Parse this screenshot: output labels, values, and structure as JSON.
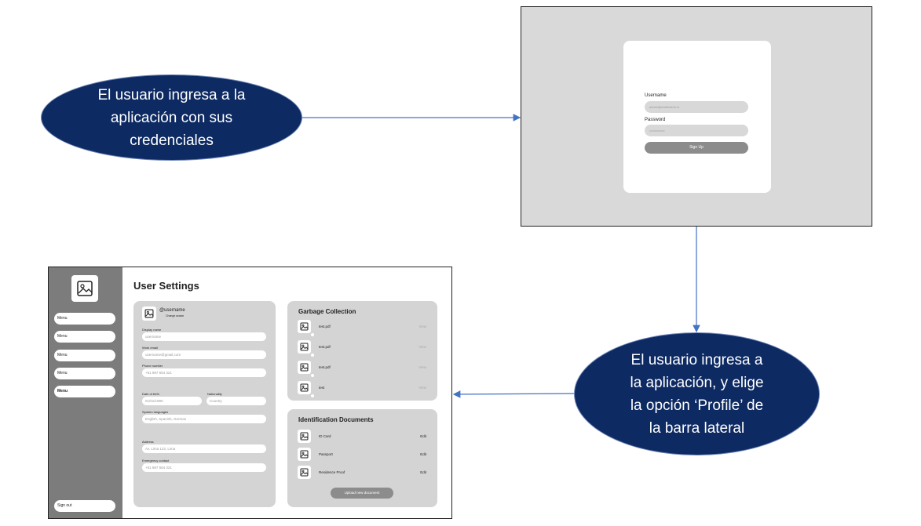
{
  "flow": {
    "step1_text": "El usuario ingresa a la\naplicación con sus\ncredenciales",
    "step2_text": "El usuario ingresa a\nla aplicación, y elige\nla opción ‘Profile’ de\nla barra lateral",
    "ellipse_color": "#0d2a63",
    "arrow_color": "#4472c4"
  },
  "login": {
    "username_label": "Username",
    "username_placeholder": "admin@rewishtech.io",
    "password_label": "Password",
    "password_value": "••••••••••••••",
    "submit_label": "Sign Up"
  },
  "settings": {
    "title": "User Settings",
    "sidebar": {
      "logo_icon": "image-icon",
      "items": [
        "Menu",
        "Menu",
        "Menu",
        "Menu",
        "Menu"
      ],
      "active_index": 4,
      "signout_label": "Sign out"
    },
    "profile": {
      "username": "@username",
      "change_avatar": "Change avatar",
      "display_name_label": "Display name",
      "display_name_placeholder": "username",
      "work_email_label": "Work email",
      "work_email_placeholder": "username@gmail.com",
      "phone_label": "Phone number",
      "phone_placeholder": "+51 987 654 321",
      "dob_label": "Date of birth",
      "dob_placeholder": "01/01/1990",
      "nationality_label": "Nationality",
      "nationality_placeholder": "Country",
      "languages_label": "Spoken languages",
      "languages_placeholder": "English, Spanish, German",
      "address_label": "Address",
      "address_placeholder": "Av. Lima 123, Lima",
      "emergency_label": "Emergency contact",
      "emergency_placeholder": "+51 987 564 321"
    },
    "garbage": {
      "title": "Garbage Collection",
      "files": [
        {
          "name": "test.pdf",
          "action": "View"
        },
        {
          "name": "test.pdf",
          "action": "View"
        },
        {
          "name": "test.pdf",
          "action": "View"
        },
        {
          "name": "test",
          "action": "View"
        }
      ]
    },
    "documents": {
      "title": "Identification Documents",
      "items": [
        {
          "name": "ID Card",
          "action": "Edit"
        },
        {
          "name": "Passport",
          "action": "Edit"
        },
        {
          "name": "Residence Proof",
          "action": "Edit"
        }
      ],
      "upload_label": "Upload new document"
    }
  }
}
